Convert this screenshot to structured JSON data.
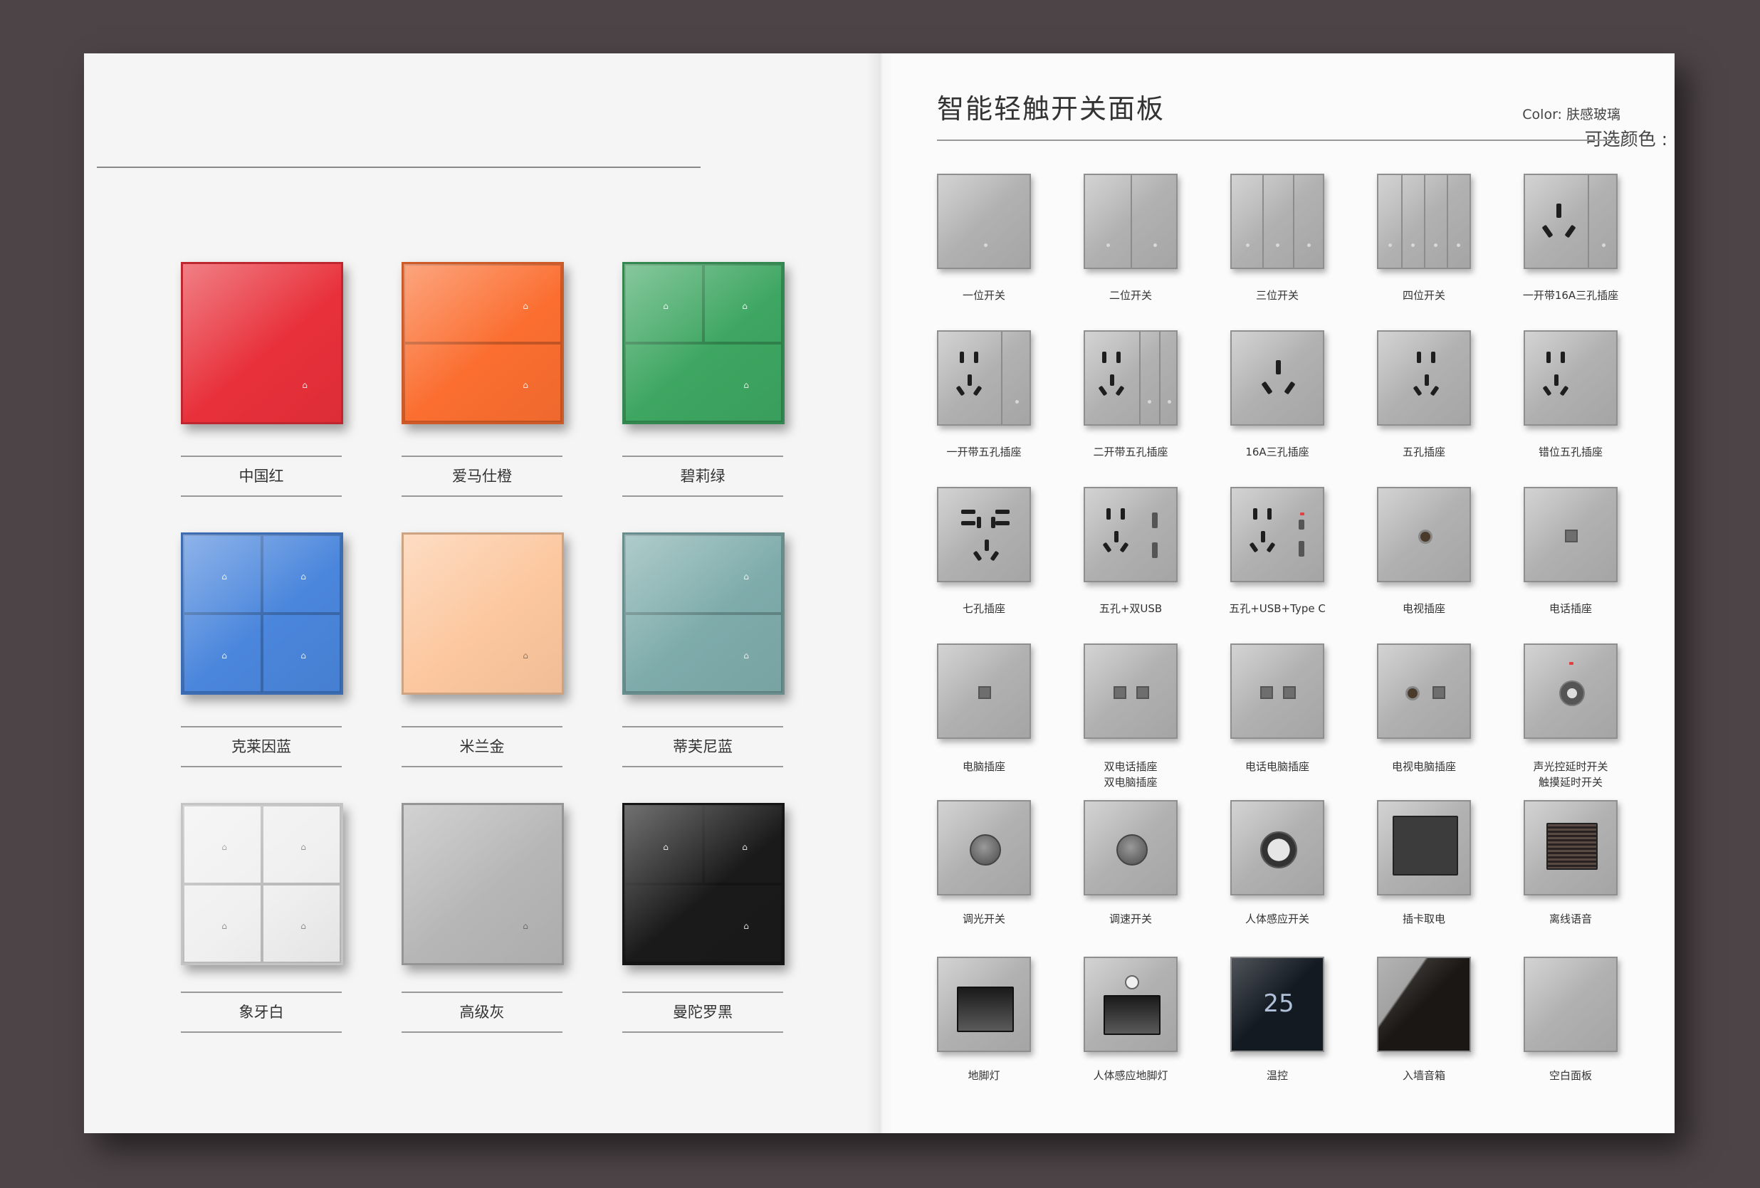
{
  "left": {
    "heading": "可选颜色 :",
    "swatches": [
      {
        "label": "中国红",
        "color": "#e8303a",
        "layout": "1"
      },
      {
        "label": "爱马仕橙",
        "color": "#fb6e30",
        "layout": "2h"
      },
      {
        "label": "碧莉绿",
        "color": "#3da661",
        "layout": "3"
      },
      {
        "label": "克莱因蓝",
        "color": "#4a86dc",
        "layout": "4"
      },
      {
        "label": "米兰金",
        "color": "#fcc79e",
        "layout": "1"
      },
      {
        "label": "蒂芙尼蓝",
        "color": "#7eacab",
        "layout": "2h"
      },
      {
        "label": "象牙白",
        "color": "#f0f0f0",
        "layout": "4"
      },
      {
        "label": "高级灰",
        "color": "#b6b6b6",
        "layout": "1"
      },
      {
        "label": "曼陀罗黑",
        "color": "#1a1a1a",
        "layout": "3"
      }
    ]
  },
  "right": {
    "title": "智能轻触开关面板",
    "color_label": "Color: 肤感玻璃",
    "products": [
      {
        "label": "一位开关",
        "icon": "switch-1-gang-icon"
      },
      {
        "label": "二位开关",
        "icon": "switch-2-gang-icon"
      },
      {
        "label": "三位开关",
        "icon": "switch-3-gang-icon"
      },
      {
        "label": "四位开关",
        "icon": "switch-4-gang-icon"
      },
      {
        "label": "一开带16A三孔插座",
        "icon": "switch-16a-socket-icon"
      },
      {
        "label": "一开带五孔插座",
        "icon": "switch-five-hole-socket-icon"
      },
      {
        "label": "二开带五孔插座",
        "icon": "double-switch-five-hole-socket-icon"
      },
      {
        "label": "16A三孔插座",
        "icon": "socket-16a-three-hole-icon"
      },
      {
        "label": "五孔插座",
        "icon": "five-hole-socket-icon"
      },
      {
        "label": "错位五孔插座",
        "icon": "offset-five-hole-socket-icon"
      },
      {
        "label": "七孔插座",
        "icon": "seven-hole-socket-icon"
      },
      {
        "label": "五孔+双USB",
        "icon": "five-hole-dual-usb-icon"
      },
      {
        "label": "五孔+USB+Type C",
        "icon": "five-hole-usb-typec-icon"
      },
      {
        "label": "电视插座",
        "icon": "tv-socket-icon"
      },
      {
        "label": "电话插座",
        "icon": "phone-socket-icon"
      },
      {
        "label": "电脑插座",
        "icon": "computer-socket-icon"
      },
      {
        "label": "双电话插座\n双电脑插座",
        "icon": "double-phone-computer-socket-icon"
      },
      {
        "label": "电话电脑插座",
        "icon": "phone-computer-socket-icon"
      },
      {
        "label": "电视电脑插座",
        "icon": "tv-computer-socket-icon"
      },
      {
        "label": "声光控延时开关\n触摸延时开关",
        "icon": "sound-light-delay-switch-icon"
      },
      {
        "label": "调光开关",
        "icon": "dimmer-switch-icon"
      },
      {
        "label": "调速开关",
        "icon": "fan-speed-switch-icon"
      },
      {
        "label": "人体感应开关",
        "icon": "motion-sensor-switch-icon"
      },
      {
        "label": "插卡取电",
        "icon": "card-power-switch-icon"
      },
      {
        "label": "离线语音",
        "icon": "offline-voice-icon"
      },
      {
        "label": "地脚灯",
        "icon": "foot-light-icon"
      },
      {
        "label": "人体感应地脚灯",
        "icon": "motion-foot-light-icon"
      },
      {
        "label": "温控",
        "icon": "thermostat-icon"
      },
      {
        "label": "入墙音箱",
        "icon": "in-wall-speaker-icon"
      },
      {
        "label": "空白面板",
        "icon": "blank-panel-icon"
      }
    ]
  }
}
